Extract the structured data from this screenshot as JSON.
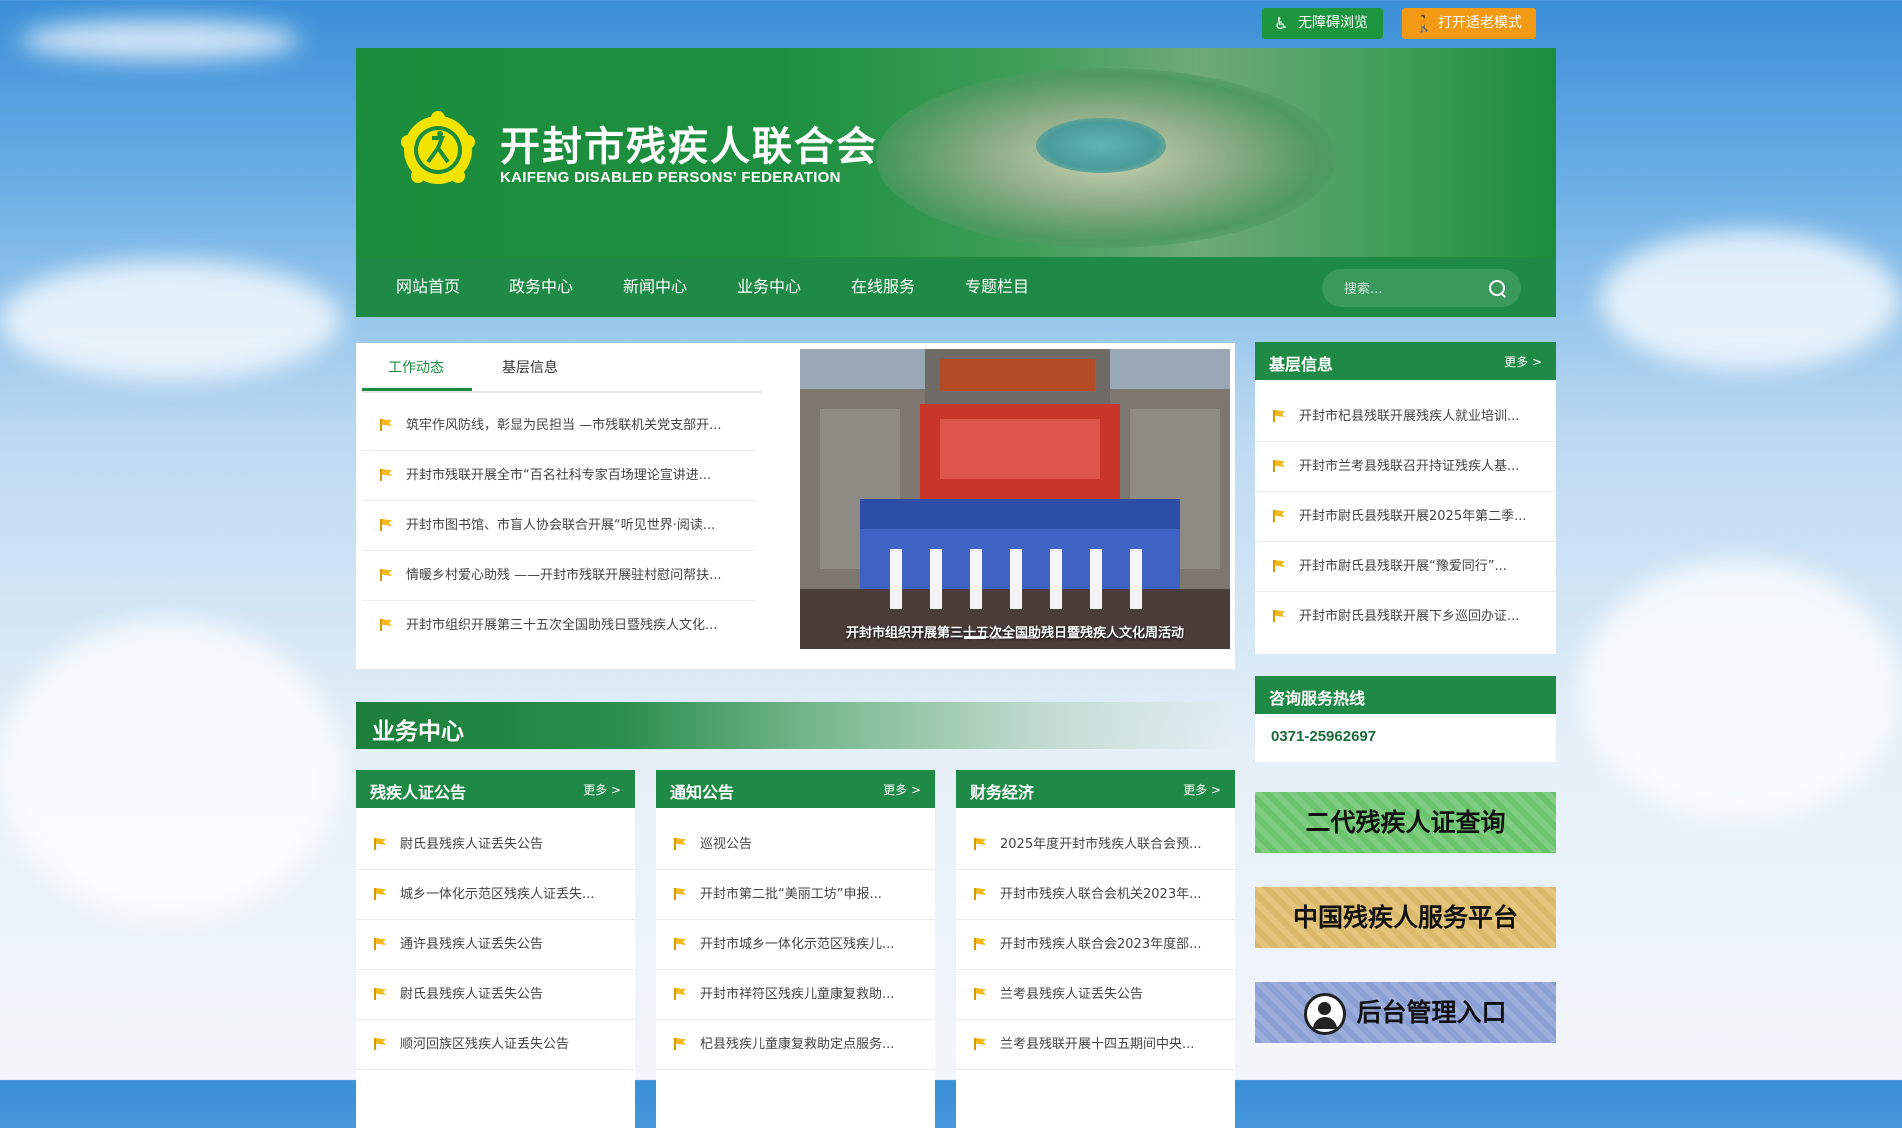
{
  "topbar": {
    "accessible_label": "无障碍浏览",
    "elder_mode_label": "打开适老模式"
  },
  "header": {
    "title": "开封市残疾人联合会",
    "subtitle": "KAIFENG DISABLED PERSONS' FEDERATION"
  },
  "nav": {
    "items": [
      "网站首页",
      "政务中心",
      "新闻中心",
      "业务中心",
      "在线服务",
      "专题栏目"
    ],
    "search_placeholder": "搜索..."
  },
  "news": {
    "tabs": [
      "工作动态",
      "基层信息"
    ],
    "items": [
      "筑牢作风防线，彰显为民担当 —市残联机关党支部开...",
      "开封市残联开展全市“百名社科专家百场理论宣讲进...",
      "开封市图书馆、市盲人协会联合开展“听见世界·阅读...",
      "情暖乡村爱心助残 ——开封市残联开展驻村慰问帮扶...",
      "开封市组织开展第三十五次全国助残日暨残疾人文化..."
    ],
    "photo_caption": "开封市组织开展第三十五次全国助残日暨残疾人文化周活动"
  },
  "grassroots": {
    "title": "基层信息",
    "more": "更多 >",
    "items": [
      "开封市杞县残联开展残疾人就业培训...",
      "开封市兰考县残联召开持证残疾人基...",
      "开封市尉氏县残联开展2025年第二季...",
      "开封市尉氏县残联开展“豫爱同行”...",
      "开封市尉氏县残联开展下乡巡回办证..."
    ]
  },
  "hotline": {
    "title": "咨询服务热线",
    "number": "0371-25962697"
  },
  "business": {
    "title": "业务中心",
    "columns": [
      {
        "title": "残疾人证公告",
        "more": "更多 >",
        "items": [
          "尉氏县残疾人证丢失公告",
          "城乡一体化示范区残疾人证丢失...",
          "通许县残疾人证丢失公告",
          "尉氏县残疾人证丢失公告",
          "顺河回族区残疾人证丢失公告"
        ]
      },
      {
        "title": "通知公告",
        "more": "更多 >",
        "items": [
          "巡视公告",
          "开封市第二批“美丽工坊”申报...",
          "开封市城乡一体化示范区残疾儿...",
          "开封市祥符区残疾儿童康复救助...",
          "杞县残疾儿童康复救助定点服务..."
        ]
      },
      {
        "title": "财务经济",
        "more": "更多 >",
        "items": [
          "2025年度开封市残疾人联合会预...",
          "开封市残疾人联合会机关2023年...",
          "开封市残疾人联合会2023年度部...",
          "兰考县残疾人证丢失公告",
          "兰考县残联开展十四五期间中央..."
        ]
      }
    ]
  },
  "promos": {
    "cert_query": "二代残疾人证查询",
    "service_platform": "中国残疾人服务平台",
    "admin_entry": "后台管理入口"
  },
  "colors": {
    "brand_green": "#1f8a45",
    "elder_orange": "#f39a14",
    "list_flag": "#f2b91a"
  }
}
